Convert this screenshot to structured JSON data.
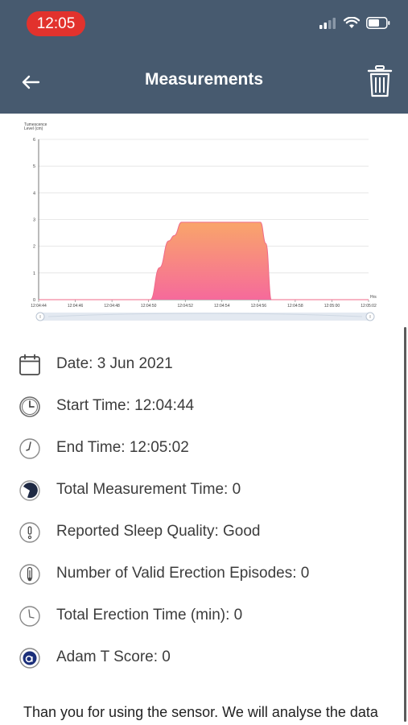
{
  "status_bar": {
    "time": "12:05",
    "icons": [
      "cellular-signal-icon",
      "wifi-icon",
      "battery-icon"
    ]
  },
  "header": {
    "title": "Measurements",
    "back_icon": "arrow-left-icon",
    "delete_icon": "trash-icon"
  },
  "chart_data": {
    "type": "area",
    "ylabel": "Tumescence\nLevel (cm)",
    "xlabel": "Hrs",
    "ylim": [
      0,
      6
    ],
    "y_ticks": [
      "0",
      "1",
      "2",
      "3",
      "4",
      "5",
      "6"
    ],
    "x_ticks": [
      "12:04:44",
      "12:04:46",
      "12:04:48",
      "12:04:50",
      "12:04:52",
      "12:04:54",
      "12:04:56",
      "12:04:58",
      "12:05:00",
      "12:05:02"
    ],
    "grid": true,
    "fill_colors": [
      "#f9a56a",
      "#f66a9b"
    ],
    "x": [
      "12:04:44",
      "12:04:50.1",
      "12:04:50.6",
      "12:04:51.1",
      "12:04:51.4",
      "12:04:51.8",
      "12:04:56.1",
      "12:04:56.4",
      "12:04:56.7",
      "12:05:02"
    ],
    "values": [
      0,
      0,
      1.2,
      2.2,
      2.4,
      2.9,
      2.9,
      2.1,
      0,
      0
    ]
  },
  "details": [
    {
      "icon": "calendar-icon",
      "text": "Date: 3 Jun 2021"
    },
    {
      "icon": "clock-icon",
      "text": "Start Time: 12:04:44"
    },
    {
      "icon": "clock-end-icon",
      "text": "End Time: 12:05:02"
    },
    {
      "icon": "pie-timer-icon",
      "text": "Total Measurement Time: 0"
    },
    {
      "icon": "sleep-quality-icon",
      "text": "Reported Sleep Quality: Good"
    },
    {
      "icon": "thermometer-icon",
      "text": "Number of Valid Erection Episodes: 0"
    },
    {
      "icon": "clock-duration-icon",
      "text": "Total Erection Time (min): 0"
    },
    {
      "icon": "score-icon",
      "text": "Adam T Score: 0"
    }
  ],
  "footer": {
    "text": "Than you for using the sensor. We will analyse the data"
  }
}
